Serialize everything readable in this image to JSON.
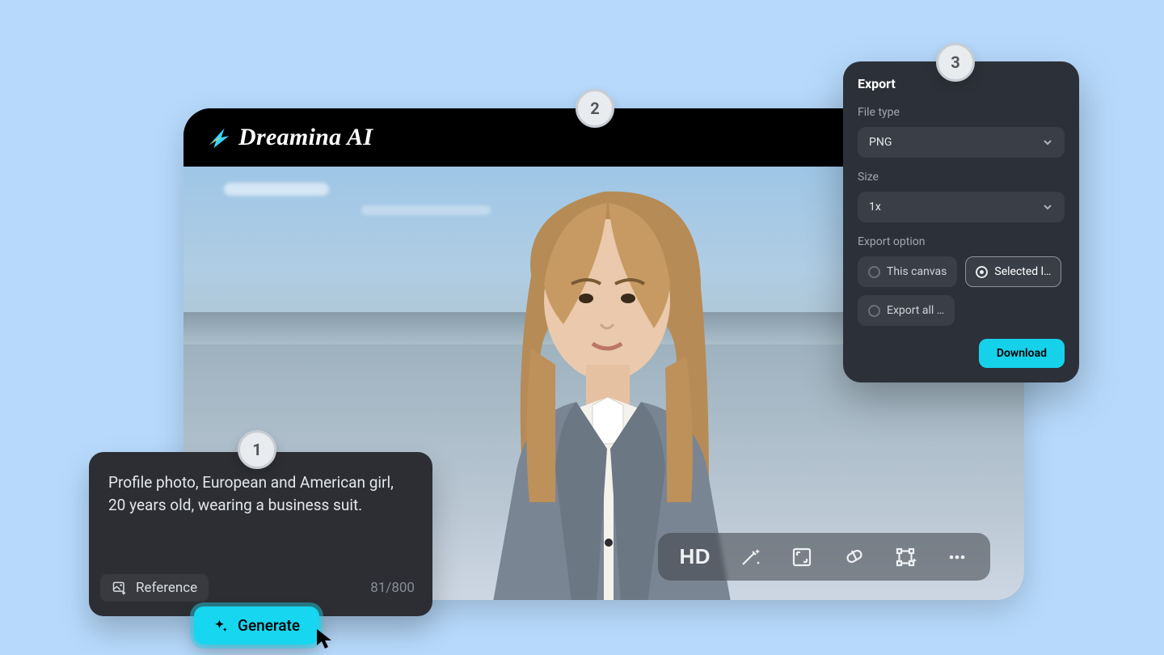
{
  "app": {
    "title": "Dreamina AI"
  },
  "steps": {
    "one": "1",
    "two": "2",
    "three": "3"
  },
  "prompt": {
    "text": "Profile photo, European and American girl, 20 years old, wearing a business suit.",
    "reference_label": "Reference",
    "char_count": "81/800",
    "generate_label": "Generate"
  },
  "toolbar": {
    "hd_label": "HD"
  },
  "export": {
    "title": "Export",
    "file_type_label": "File type",
    "file_type_value": "PNG",
    "size_label": "Size",
    "size_value": "1x",
    "option_label": "Export option",
    "options": {
      "this_canvas": "This canvas",
      "selected": "Selected l…",
      "all": "Export all …"
    },
    "download_label": "Download"
  }
}
